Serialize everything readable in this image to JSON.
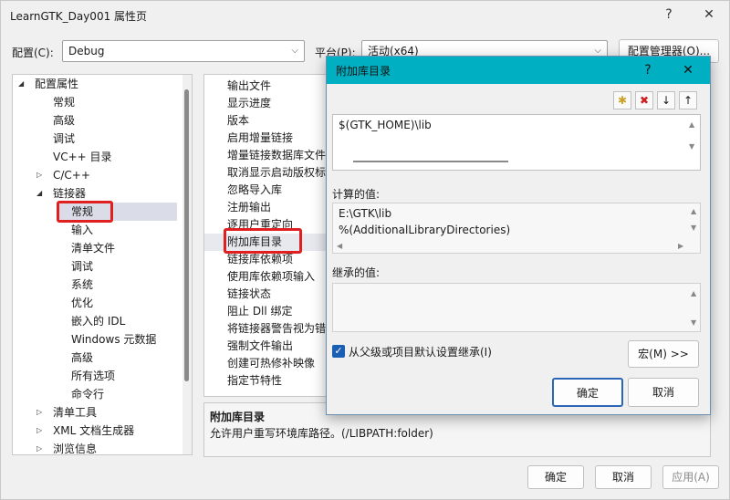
{
  "window": {
    "title": "LearnGTK_Day001 属性页",
    "help_glyph": "?",
    "close_glyph": "✕"
  },
  "top": {
    "config_label": "配置(C):",
    "config_value": "Debug",
    "platform_label": "平台(P):",
    "platform_value": "活动(x64)",
    "config_manager": "配置管理器(O)..."
  },
  "tree": {
    "items": [
      {
        "label": "配置属性",
        "expander": "◢"
      },
      {
        "label": "常规"
      },
      {
        "label": "高级"
      },
      {
        "label": "调试"
      },
      {
        "label": "VC++ 目录"
      },
      {
        "label": "C/C++",
        "expander": "▷"
      },
      {
        "label": "链接器",
        "expander": "◢"
      },
      {
        "label": "常规"
      },
      {
        "label": "输入"
      },
      {
        "label": "清单文件"
      },
      {
        "label": "调试"
      },
      {
        "label": "系统"
      },
      {
        "label": "优化"
      },
      {
        "label": "嵌入的 IDL"
      },
      {
        "label": "Windows 元数据"
      },
      {
        "label": "高级"
      },
      {
        "label": "所有选项"
      },
      {
        "label": "命令行"
      },
      {
        "label": "清单工具",
        "expander": "▷"
      },
      {
        "label": "XML 文档生成器",
        "expander": "▷"
      },
      {
        "label": "浏览信息",
        "expander": "▷"
      }
    ]
  },
  "properties": {
    "rows": [
      "输出文件",
      "显示进度",
      "版本",
      "启用增量链接",
      "增量链接数据库文件",
      "取消显示启动版权标",
      "忽略导入库",
      "注册输出",
      "逐用户重定向",
      "附加库目录",
      "链接库依赖项",
      "使用库依赖项输入",
      "链接状态",
      "阻止 Dll 绑定",
      "将链接器警告视为错",
      "强制文件输出",
      "创建可热修补映像",
      "指定节特性"
    ]
  },
  "description": {
    "title": "附加库目录",
    "text": "允许用户重写环境库路径。(/LIBPATH:folder)"
  },
  "bottom": {
    "ok": "确定",
    "cancel": "取消",
    "apply": "应用(A)"
  },
  "dialog": {
    "title": "附加库目录",
    "help_glyph": "?",
    "close_glyph": "✕",
    "entry": "$(GTK_HOME)\\lib",
    "computed_label": "计算的值:",
    "computed_lines": [
      "E:\\GTK\\lib",
      "%(AdditionalLibraryDirectories)"
    ],
    "inherited_label": "继承的值:",
    "inherit_checkbox_label": "从父级或项目默认设置继承(I)",
    "inherit_checked": true,
    "macros_button": "宏(M) >>",
    "ok": "确定",
    "cancel": "取消",
    "toolbar_glyphs": {
      "new": "✱",
      "delete": "✖",
      "down": "↓",
      "up": "↑"
    }
  },
  "colors": {
    "dialog_title_bg": "#00afc1",
    "highlight_red": "#e02020",
    "checkbox_blue": "#1a5fb4"
  }
}
